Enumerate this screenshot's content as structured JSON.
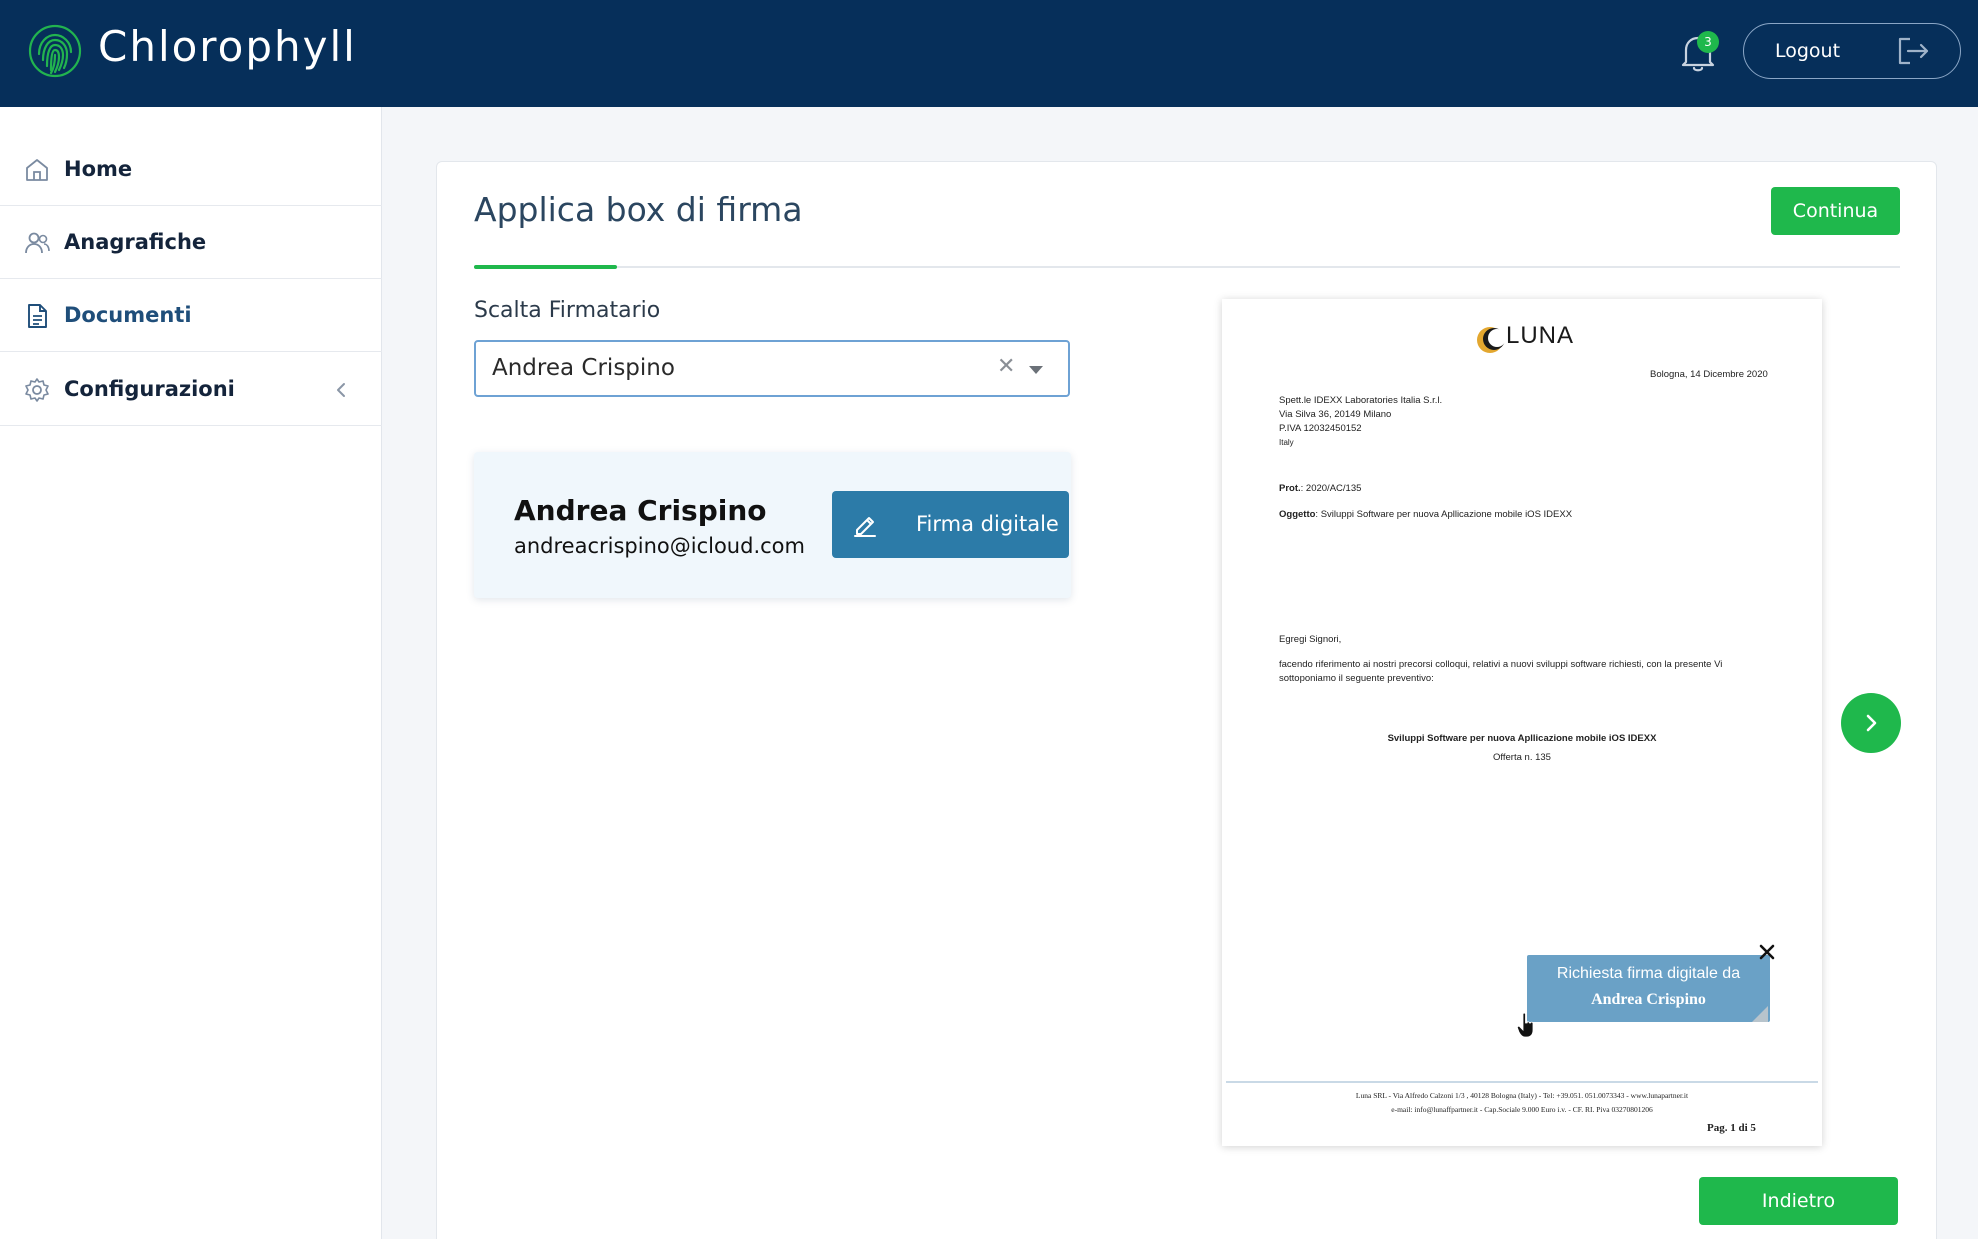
{
  "header": {
    "brand": "Chlorophyll",
    "notifications_count": "3",
    "logout_label": "Logout"
  },
  "sidebar": {
    "items": [
      {
        "label": "Home",
        "icon": "home-icon"
      },
      {
        "label": "Anagrafiche",
        "icon": "users-icon"
      },
      {
        "label": "Documenti",
        "icon": "document-icon",
        "active": true
      },
      {
        "label": "Configurazioni",
        "icon": "gear-icon",
        "has_submenu": true
      }
    ]
  },
  "main": {
    "title": "Applica box di firma",
    "continue_label": "Continua",
    "signer_label": "Scalta Firmatario",
    "selected_signer": "Andrea Crispino",
    "signer_card": {
      "name": "Andrea Crispino",
      "email": "andreacrispino@icloud.com",
      "button_label": "Firma digitale"
    },
    "back_label": "Indietro"
  },
  "document": {
    "logo_text": "LUNA",
    "date": "Bologna, 14 Dicembre  2020",
    "address_lines": [
      "Spett.le IDEXX Laboratories Italia S.r.l.",
      "Via Silva 36, 20149 Milano",
      "P.IVA 12032450152",
      "Italy"
    ],
    "prot_label": "Prot.",
    "prot_value": ": 2020/AC/135",
    "oggetto_label": "Oggetto",
    "oggetto_value": ": Sviluppi Software per nuova Apllicazione mobile iOS IDEXX",
    "greeting": "Egregi Signori,",
    "body": "facendo riferimento ai nostri precorsi colloqui, relativi a nuovi sviluppi software richiesti, con la presente Vi sottoponiamo il seguente preventivo:",
    "subject": "Sviluppi Software per nuova Apllicazione mobile iOS IDEXX",
    "offer": "Offerta n. 135",
    "footer_line1": "Luna SRL - Via Alfredo Calzoni 1/3 , 40128 Bologna (Italy) - Tel: +39.051. 051.0073343 -  www.lunapartner.it",
    "footer_line2": "e-mail: info@lunaffpartner.it - Cap.Sociale 9.000 Euro i.v. - CF. RI. Piva 03270801206",
    "page_info": "Pag. 1 di  5",
    "signature_box": {
      "line1": "Richiesta firma digitale da",
      "line2": "Andrea Crispino"
    }
  },
  "colors": {
    "header_bg": "#062f5a",
    "accent_green": "#1fb84c",
    "firma_blue": "#2c7ba8",
    "signature_box": "#6aa1c6"
  }
}
